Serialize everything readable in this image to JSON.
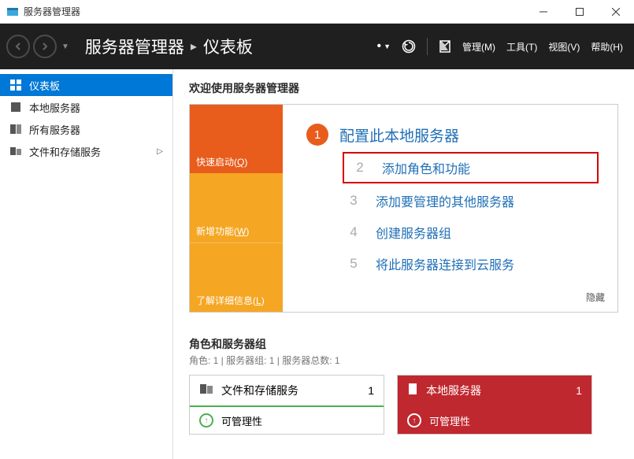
{
  "titlebar": {
    "title": "服务器管理器"
  },
  "header": {
    "breadcrumb1": "服务器管理器",
    "breadcrumb2": "仪表板",
    "menu": {
      "manage": "管理(M)",
      "tools": "工具(T)",
      "view": "视图(V)",
      "help": "帮助(H)"
    }
  },
  "sidebar": {
    "dashboard": "仪表板",
    "local_server": "本地服务器",
    "all_servers": "所有服务器",
    "file_storage": "文件和存储服务"
  },
  "welcome": {
    "title": "欢迎使用服务器管理器",
    "tabs": {
      "quickstart": "快速启动(Q)",
      "whatsnew": "新增功能(W)",
      "learnmore": "了解详细信息(L)"
    },
    "tasks": {
      "t1": "配置此本地服务器",
      "t2": "添加角色和功能",
      "t3": "添加要管理的其他服务器",
      "t4": "创建服务器组",
      "t5": "将此服务器连接到云服务"
    },
    "hide": "隐藏"
  },
  "roles": {
    "title": "角色和服务器组",
    "subtitle": "角色: 1 | 服务器组: 1 | 服务器总数: 1",
    "tile1": {
      "title": "文件和存储服务",
      "count": "1",
      "row1": "可管理性"
    },
    "tile2": {
      "title": "本地服务器",
      "count": "1",
      "row1": "可管理性"
    }
  }
}
